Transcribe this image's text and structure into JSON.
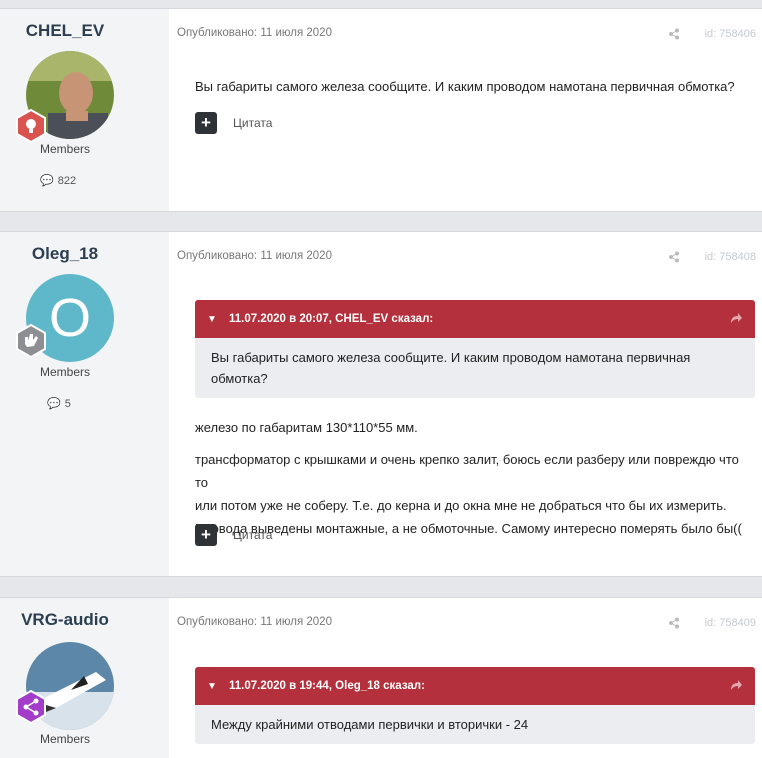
{
  "posts": [
    {
      "author": "CHEL_EV",
      "group": "Members",
      "count": "822",
      "meta": "Опубликовано: 11 июля 2020",
      "id": "id: 758406",
      "lines": [
        "Вы габариты самого железа сообщите. И каким проводом намотана первичная обмотка?"
      ],
      "quote_label": "Цитата"
    },
    {
      "author": "Oleg_18",
      "group": "Members",
      "count": "5",
      "avatar_letter": "O",
      "meta": "Опубликовано: 11 июля 2020",
      "id": "id: 758408",
      "quote": {
        "header": "11.07.2020 в 20:07, CHEL_EV сказал:",
        "lines": [
          "Вы габариты самого железа сообщите. И каким проводом намотана первичная",
          "обмотка?"
        ]
      },
      "lines": [
        "железо по габаритам 130*110*55 мм.",
        "трансформатор с крышками и очень крепко залит, боюсь если разберу или повреждю что то",
        "или потом уже не соберу.  Т.е. до керна и до окна мне не добраться что бы их измерить.",
        "Провода выведены монтажные, а не обмоточные. Самому интересно померять было бы(("
      ],
      "quote_label": "Цитата"
    },
    {
      "author": "VRG-audio",
      "group": "Members",
      "meta": "Опубликовано: 11 июля 2020",
      "id": "id: 758409",
      "quote": {
        "header": "11.07.2020 в 19:44, Oleg_18 сказал:",
        "lines": [
          "Между крайними отводами первички и вторички  -  24"
        ]
      }
    }
  ],
  "colors": {
    "quote_header": "#b3303c",
    "badge_red": "#d9534f",
    "badge_purple": "#a33cc8",
    "avatar_teal": "#5fb8c9"
  }
}
